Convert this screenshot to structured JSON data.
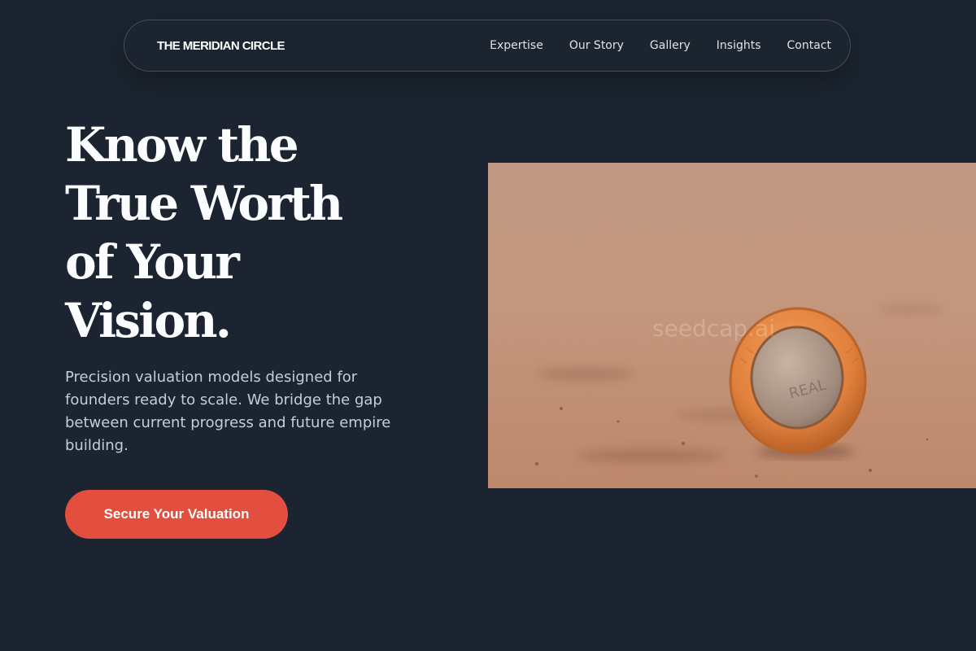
{
  "nav": {
    "brand": "THE MERIDIAN CIRCLE",
    "links": [
      "Expertise",
      "Our Story",
      "Gallery",
      "Insights",
      "Contact"
    ]
  },
  "hero": {
    "headline_lines": [
      "Know the",
      "True Worth",
      "of Your",
      "Vision."
    ],
    "subtitle": "Precision valuation models designed for founders ready to scale. We bridge the gap between current progress and future empire building.",
    "cta_label": "Secure Your Valuation"
  },
  "image": {
    "subject": "coin standing on sand",
    "watermark": "seedcap.ai"
  },
  "colors": {
    "background": "#1b2430",
    "accent": "#e34f3e",
    "text": "#ffffff",
    "muted_text": "#c4ceda"
  }
}
